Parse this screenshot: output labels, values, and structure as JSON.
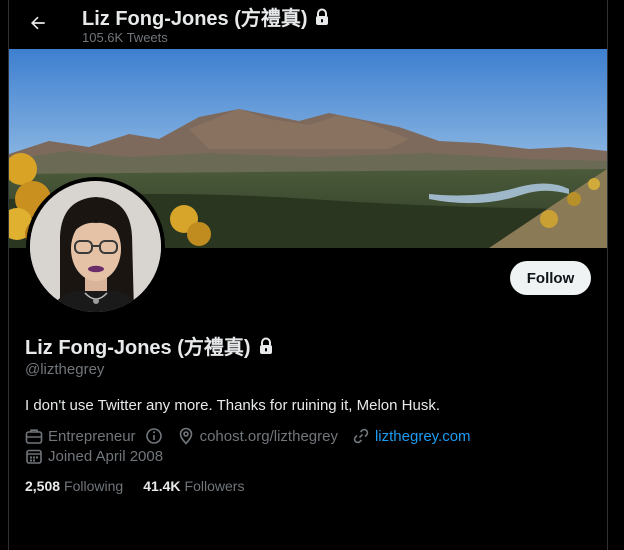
{
  "header": {
    "back_label": "Back",
    "title": "Liz Fong-Jones (方禮真)",
    "tweet_count": "105.6K Tweets"
  },
  "profile": {
    "display_name": "Liz Fong-Jones (方禮真)",
    "handle": "@lizthegrey",
    "bio": "I don't use Twitter any more. Thanks for ruining it, Melon Husk.",
    "follow_label": "Follow",
    "category": "Entrepreneur",
    "location": "cohost.org/lizthegrey",
    "website": "lizthegrey.com",
    "joined": "Joined April 2008",
    "following_count": "2,508",
    "following_label": "Following",
    "followers_count": "41.4K",
    "followers_label": "Followers"
  },
  "icons": {
    "back": "arrow-left-icon",
    "protected": "lock-icon",
    "category": "briefcase-icon",
    "info": "info-icon",
    "location": "location-pin-icon",
    "website": "link-icon",
    "joined": "calendar-icon"
  },
  "colors": {
    "background": "#000000",
    "text": "#e7e9ea",
    "muted": "#71767b",
    "link": "#1d9bf0",
    "follow_bg": "#eff3f4"
  }
}
